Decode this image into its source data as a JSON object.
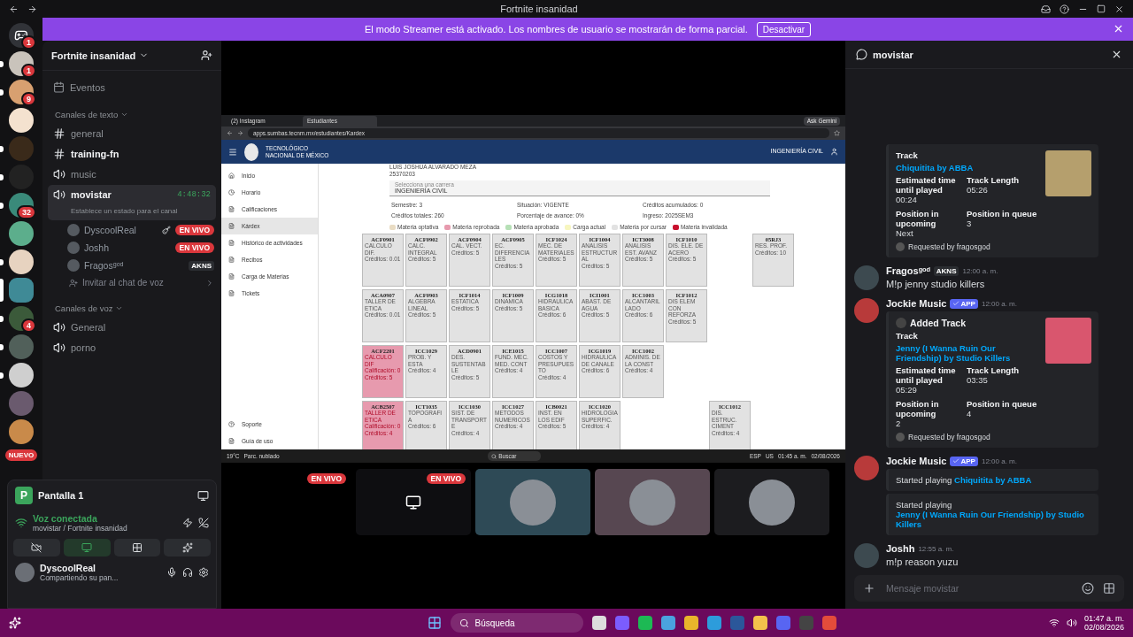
{
  "titlebar": {
    "title": "Fortnite insanidad"
  },
  "banner": {
    "text": "El modo Streamer está activado. Los nombres de usuario se mostrarán de forma parcial.",
    "button": "Desactivar"
  },
  "servers": [
    {
      "kind": "home",
      "badge": "1",
      "unread": false,
      "selected": false,
      "color": "#313338"
    },
    {
      "kind": "server",
      "badge": "1",
      "unread": true,
      "selected": false,
      "color": "#c9c3bb"
    },
    {
      "kind": "server",
      "badge": "9",
      "unread": true,
      "selected": false,
      "color": "#d8a070"
    },
    {
      "kind": "server",
      "unread": false,
      "selected": false,
      "color": "#f4e2cf"
    },
    {
      "kind": "server",
      "unread": true,
      "selected": false,
      "color": "#3a2a1a"
    },
    {
      "kind": "server",
      "unread": true,
      "selected": false,
      "color": "#222222"
    },
    {
      "kind": "server",
      "badge": "32",
      "unread": true,
      "selected": false,
      "color": "#3a8a7a"
    },
    {
      "kind": "server",
      "unread": false,
      "selected": false,
      "color": "#5cae8c"
    },
    {
      "kind": "server",
      "unread": true,
      "selected": false,
      "color": "#e7d3c0"
    },
    {
      "kind": "server",
      "unread": false,
      "selected": true,
      "color": "#3f8a96"
    },
    {
      "kind": "server",
      "badge": "4",
      "unread": true,
      "selected": false,
      "color": "#3b5a3a"
    },
    {
      "kind": "server",
      "unread": true,
      "selected": false,
      "color": "#51605a"
    },
    {
      "kind": "server",
      "unread": true,
      "selected": false,
      "color": "#cfcfcf"
    },
    {
      "kind": "server",
      "unread": false,
      "selected": false,
      "color": "#6a5a6e"
    },
    {
      "kind": "server",
      "unread": false,
      "selected": false,
      "color": "#c98a4a"
    }
  ],
  "new_label": "NUEVO",
  "server": {
    "name": "Fortnite insanidad",
    "events": "Eventos"
  },
  "categories": [
    {
      "name": "Canales de texto",
      "channels": [
        {
          "kind": "text",
          "name": "general",
          "unread": false,
          "selected": false
        },
        {
          "kind": "text",
          "name": "training-fn",
          "unread": true,
          "selected": false
        },
        {
          "kind": "voice",
          "name": "music",
          "unread": false,
          "selected": false
        },
        {
          "kind": "voice",
          "name": "movistar",
          "unread": true,
          "selected": true,
          "timer": "4:48:32",
          "status": "Establece un estado para el canal",
          "members": [
            {
              "name": "DyscoolReal",
              "live": "EN VIVO"
            },
            {
              "name": "Joshh",
              "live": "EN VIVO"
            },
            {
              "name": "Fragosᵍᵒᵈ",
              "tag": "AKNS"
            }
          ],
          "invite": "Invitar al chat de voz"
        }
      ]
    },
    {
      "name": "Canales de voz",
      "channels": [
        {
          "kind": "voice",
          "name": "General",
          "unread": false,
          "selected": false
        },
        {
          "kind": "voice",
          "name": "porno",
          "unread": false,
          "selected": false
        }
      ]
    }
  ],
  "stream_panel": {
    "letter": "P",
    "title": "Pantalla 1"
  },
  "voice": {
    "status": "Voz conectada",
    "channel": "movistar / Fortnite insanidad"
  },
  "voice_buttons": [
    {
      "kind": "camera",
      "selected": false
    },
    {
      "kind": "screen",
      "selected": true
    },
    {
      "kind": "activities",
      "selected": false
    },
    {
      "kind": "soundboard",
      "selected": false
    }
  ],
  "user": {
    "name": "DyscoolReal",
    "status": "Compartiendo su pan..."
  },
  "stream": {
    "tabs": [
      {
        "label": "(2) Instagram",
        "selected": false
      },
      {
        "label": "Estudiantes",
        "selected": true
      }
    ],
    "gemini": "Ask Gemini",
    "url": "apps.sumbas.tecnm.mx/estudiantes/Kardex",
    "org": "TECNOLÓGICO NACIONAL DE MÉXICO",
    "career_header": "INGENIERÍA CIVIL",
    "nav": [
      {
        "label": "Inicio",
        "selected": false
      },
      {
        "label": "Horario",
        "selected": false
      },
      {
        "label": "Calificaciones",
        "selected": false
      },
      {
        "label": "Kárdex",
        "selected": true
      },
      {
        "label": "Histórico de actividades",
        "selected": false
      },
      {
        "label": "Recibos",
        "selected": false
      },
      {
        "label": "Carga de Materias",
        "selected": false
      },
      {
        "label": "Tickets",
        "selected": false
      }
    ],
    "nav_bottom": [
      {
        "label": "Soporte",
        "selected": false
      },
      {
        "label": "Guía de uso",
        "selected": false
      }
    ],
    "student": [
      "LUIS JOSHUA ALVARADO MEZA",
      "25370203"
    ],
    "select": {
      "placeholder": "Selecciona una carrera",
      "value": "INGENIERÍA CIVIL"
    },
    "stats": [
      [
        "Semestre: 3",
        "Situación: VIGENTE",
        "Créditos acumulados: 0"
      ],
      [
        "Créditos totales: 260",
        "Porcentaje de avance: 0%",
        "Ingreso: 2025SEM3"
      ]
    ],
    "legend": [
      {
        "label": "Materia optativa",
        "color": "#e9dcc3"
      },
      {
        "label": "Materia reprobada",
        "color": "#e79aae"
      },
      {
        "label": "Materia aprobada",
        "color": "#b6e0b6"
      },
      {
        "label": "Carga actual",
        "color": "#f7f6bf"
      },
      {
        "label": "Materia por cursar",
        "color": "#e2e2e2"
      },
      {
        "label": "Materia invalidada",
        "color": "#c8102e"
      }
    ],
    "kardex": [
      [
        {
          "kind": "pending",
          "code": "ACF0901",
          "name": "CALCULO DIF.",
          "lines": [
            "Créditos: 0.01"
          ]
        },
        {
          "kind": "pending",
          "code": "ACF0902",
          "name": "CALC. INTEGRAL",
          "lines": [
            "Créditos: 5"
          ]
        },
        {
          "kind": "pending",
          "code": "ACF0904",
          "name": "CAL. VECT.",
          "lines": [
            "Créditos: 5"
          ]
        },
        {
          "kind": "pending",
          "code": "ACF0905",
          "name": "EC. DIFERENCIALES",
          "lines": [
            "Créditos: 5"
          ]
        },
        {
          "kind": "pending",
          "code": "ICF1024",
          "name": "MEC. DE MATERIALES",
          "lines": [
            "Créditos: 5"
          ]
        },
        {
          "kind": "pending",
          "code": "ICF1004",
          "name": "ANALISIS ESTRUCTURAL",
          "lines": [
            "Créditos: 5"
          ]
        },
        {
          "kind": "pending",
          "code": "ICT3008",
          "name": "ANALISIS EST. AVANZ",
          "lines": [
            "Créditos: 5"
          ]
        },
        {
          "kind": "pending",
          "code": "ICF1010",
          "name": "DIS. ELE. DE ACERO",
          "lines": [
            "Créditos: 5"
          ]
        },
        {
          "kind": "empty"
        },
        {
          "kind": "pending",
          "code": "05RJ3",
          "name": "RES. PROF.",
          "lines": [
            "Créditos: 10"
          ]
        }
      ],
      [
        {
          "kind": "pending",
          "code": "ACA0907",
          "name": "TALLER DE ETICA",
          "lines": [
            "Créditos: 0.01"
          ]
        },
        {
          "kind": "pending",
          "code": "ACF0903",
          "name": "ALGEBRA LINEAL",
          "lines": [
            "Créditos: 5"
          ]
        },
        {
          "kind": "pending",
          "code": "ICF1014",
          "name": "ESTATICA",
          "lines": [
            "Créditos: 5"
          ]
        },
        {
          "kind": "pending",
          "code": "ICF1009",
          "name": "DINAMICA",
          "lines": [
            "Créditos: 5"
          ]
        },
        {
          "kind": "pending",
          "code": "ICG1018",
          "name": "HIDRAULICA BASICA",
          "lines": [
            "Créditos: 6"
          ]
        },
        {
          "kind": "pending",
          "code": "ICI1001",
          "name": "ABAST. DE AGUA",
          "lines": [
            "Créditos: 5"
          ]
        },
        {
          "kind": "pending",
          "code": "ICC1003",
          "name": "ALCANTARILLADO",
          "lines": [
            "Créditos: 6"
          ]
        },
        {
          "kind": "pending",
          "code": "ICF1012",
          "name": "DIS ELEM CON REFORZA",
          "lines": [
            "Créditos: 5"
          ]
        }
      ],
      [
        {
          "kind": "failed",
          "code": "ACF2201",
          "name": "CALCULO DIF",
          "lines": [
            "Calificación: 0",
            "Créditos: 5"
          ]
        },
        {
          "kind": "pending",
          "code": "ICC1029",
          "name": "PROB. Y ESTA",
          "lines": [
            "Créditos: 4"
          ]
        },
        {
          "kind": "pending",
          "code": "ACD0901",
          "name": "DES. SUSTENTABLE",
          "lines": [
            "Créditos: 5"
          ]
        },
        {
          "kind": "pending",
          "code": "ICE1015",
          "name": "FUND. MEC. MED. CONT",
          "lines": [
            "Créditos: 4"
          ]
        },
        {
          "kind": "pending",
          "code": "ICC1007",
          "name": "COSTOS Y PRESUPUESTO",
          "lines": [
            "Créditos: 4"
          ]
        },
        {
          "kind": "pending",
          "code": "ICG1019",
          "name": "HIDRAULICA DE CANALE",
          "lines": [
            "Créditos: 6"
          ]
        },
        {
          "kind": "pending",
          "code": "ICC1002",
          "name": "ADMINIS. DE LA CONST",
          "lines": [
            "Créditos: 4"
          ]
        }
      ],
      [
        {
          "kind": "failed",
          "code": "ACB2507",
          "name": "TALLER DE ETICA",
          "lines": [
            "Calificación: 0",
            "Créditos: 4"
          ]
        },
        {
          "kind": "pending",
          "code": "ICT1035",
          "name": "TOPOGRAFIA",
          "lines": [
            "Créditos: 6"
          ]
        },
        {
          "kind": "pending",
          "code": "ICC1030",
          "name": "SIST. DE TRANSPORTE",
          "lines": [
            "Créditos: 4"
          ]
        },
        {
          "kind": "pending",
          "code": "ICC1027",
          "name": "METODOS NUMERICOS",
          "lines": [
            "Créditos: 4"
          ]
        },
        {
          "kind": "pending",
          "code": "ICB0021",
          "name": "INST. EN LOS EDIF",
          "lines": [
            "Créditos: 5"
          ]
        },
        {
          "kind": "pending",
          "code": "ICC1020",
          "name": "HIDROLOGIA SUPERFIC.",
          "lines": [
            "Créditos: 4"
          ]
        },
        {
          "kind": "empty"
        },
        {
          "kind": "empty"
        },
        {
          "kind": "pending",
          "code": "ICC1012",
          "name": "DIS. ESTRUC. CIMENT",
          "lines": [
            "Créditos: 4"
          ]
        }
      ]
    ],
    "taskbar": {
      "weather": "19°C",
      "forecast": "Parc. nublado",
      "search": "Buscar",
      "lang": "ESP",
      "region": "US",
      "time": "01:45 a. m.",
      "date": "02/08/2026"
    }
  },
  "tiles": [
    {
      "kind": "blank",
      "live": "EN VIVO",
      "color": "#000000"
    },
    {
      "kind": "screen",
      "live": "EN VIVO",
      "color": "#0e0e11"
    },
    {
      "kind": "avatar",
      "color": "#2e4a56"
    },
    {
      "kind": "avatar",
      "color": "#574751"
    },
    {
      "kind": "avatar",
      "color": "#1c1c1f"
    }
  ],
  "chat": {
    "channel": "movistar",
    "placeholder": "Mensaje movistar",
    "messages": [
      {
        "embeds": [
          {
            "track_label": "Track",
            "track": "Chiquitita by ABBA",
            "fields": [
              {
                "name": "Estimated time until played",
                "value": "00:24"
              },
              {
                "name": "Track Length",
                "value": "05:26"
              },
              {
                "name": "Position in upcoming",
                "value": "Next"
              },
              {
                "name": "Position in queue",
                "value": "3"
              }
            ],
            "footer": "Requested by fragosgod"
          }
        ]
      },
      {
        "author": "Fragosᵍᵒᵈ",
        "tag": "AKNS",
        "time": "12:00 a. m.",
        "text": "M!p jenny studio killers"
      },
      {
        "author": "Jockie Music",
        "app": "APP",
        "time": "12:00 a. m.",
        "embeds": [
          {
            "title": "Added Track",
            "track_label": "Track",
            "track": "Jenny (I Wanna Ruin Our Friendship) by Studio Killers",
            "fields": [
              {
                "name": "Estimated time until played",
                "value": "05:29"
              },
              {
                "name": "Track Length",
                "value": "03:35"
              },
              {
                "name": "Position in upcoming",
                "value": "2"
              },
              {
                "name": "Position in queue",
                "value": "4"
              }
            ],
            "footer": "Requested by fragosgod"
          }
        ]
      },
      {
        "author": "Jockie Music",
        "app": "APP",
        "time": "12:00 a. m.",
        "notices": [
          {
            "text": "Started playing",
            "link": "Chiquitita by ABBA"
          },
          {
            "text": "Started playing",
            "link": "Jenny (I Wanna Ruin Our Friendship) by Studio Killers"
          }
        ]
      },
      {
        "author": "Joshh",
        "time": "12:55 a. m.",
        "text": "m!p reason yuzu"
      }
    ]
  },
  "taskbar": {
    "search": "Búsqueda",
    "time": "01:47 a. m.",
    "date": "02/08/2026"
  }
}
